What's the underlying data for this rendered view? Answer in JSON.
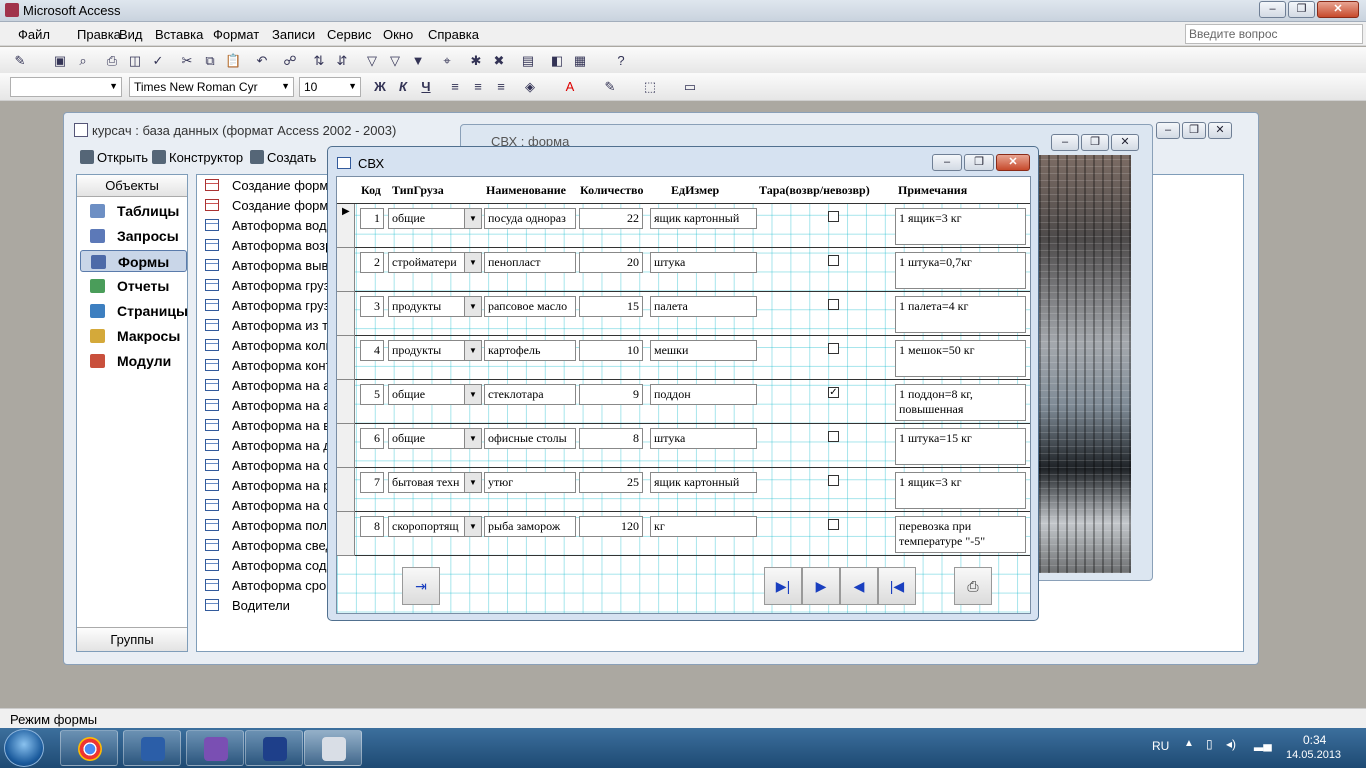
{
  "app": {
    "title": "Microsoft Access"
  },
  "menu": [
    "Файл",
    "Правка",
    "Вид",
    "Вставка",
    "Формат",
    "Записи",
    "Сервис",
    "Окно",
    "Справка"
  ],
  "help_placeholder": "Введите вопрос",
  "format_bar": {
    "font": "Times New Roman Cyr",
    "size": "10",
    "bold": "Ж",
    "italic": "К",
    "underline": "Ч"
  },
  "db_window": {
    "title": "курсач : база данных (формат Access 2002 - 2003)",
    "toolbar": {
      "open": "Открыть",
      "design": "Конструктор",
      "create": "Создать"
    },
    "objects_header": "Объекты",
    "groups": "Группы",
    "objects": [
      "Таблицы",
      "Запросы",
      "Формы",
      "Отчеты",
      "Страницы",
      "Макросы",
      "Модули"
    ],
    "forms": [
      "Создание формы",
      "Создание формы",
      "Автоформа водит",
      "Автоформа возра",
      "Автоформа вывод",
      "Автоформа грузо",
      "Автоформа грузы",
      "Автоформа из таб",
      "Автоформа колич",
      "Автоформа конта",
      "Автоформа на авт",
      "Автоформа на авт",
      "Автоформа на во",
      "Автоформа на дат",
      "Автоформа на от",
      "Автоформа на ра",
      "Автоформа на ста",
      "Автоформа получ",
      "Автоформа сведе",
      "Автоформа содер",
      "Автоформа срок",
      "Водители"
    ]
  },
  "bg_form": {
    "title": "СВХ : форма"
  },
  "svx_form": {
    "title": "СВХ",
    "headers": {
      "code": "Код",
      "type": "ТипГруза",
      "name": "Наименование",
      "qty": "Количество",
      "unit": "ЕдИзмер",
      "tara": "Тара(возвр/невозвр)",
      "notes": "Примечания"
    },
    "rows": [
      {
        "code": "1",
        "type": "общие",
        "name": "посуда однораз",
        "qty": "22",
        "unit": "ящик картонный",
        "tara": false,
        "notes": "1 ящик=3 кг"
      },
      {
        "code": "2",
        "type": "стройматери",
        "name": "пенопласт",
        "qty": "20",
        "unit": "штука",
        "tara": false,
        "notes": "1 штука=0,7кг"
      },
      {
        "code": "3",
        "type": "продукты",
        "name": "рапсовое масло",
        "qty": "15",
        "unit": "палета",
        "tara": false,
        "notes": "1 палета=4 кг"
      },
      {
        "code": "4",
        "type": "продукты",
        "name": "картофель",
        "qty": "10",
        "unit": "мешки",
        "tara": false,
        "notes": "1 мешок=50 кг"
      },
      {
        "code": "5",
        "type": "общие",
        "name": "стеклотара",
        "qty": "9",
        "unit": "поддон",
        "tara": true,
        "notes": "1 поддон=8 кг, повышенная"
      },
      {
        "code": "6",
        "type": "общие",
        "name": "офисные столы",
        "qty": "8",
        "unit": "штука",
        "tara": false,
        "notes": "1 штука=15 кг"
      },
      {
        "code": "7",
        "type": "бытовая техн",
        "name": "утюг",
        "qty": "25",
        "unit": "ящик картонный",
        "tara": false,
        "notes": "1 ящик=3 кг"
      },
      {
        "code": "8",
        "type": "скоропортящ",
        "name": "рыба заморож",
        "qty": "120",
        "unit": "кг",
        "tara": false,
        "notes": "перевозка при температуре \"-5\""
      }
    ]
  },
  "status": "Режим формы",
  "tray": {
    "lang": "RU",
    "time": "0:34",
    "date": "14.05.2013"
  }
}
